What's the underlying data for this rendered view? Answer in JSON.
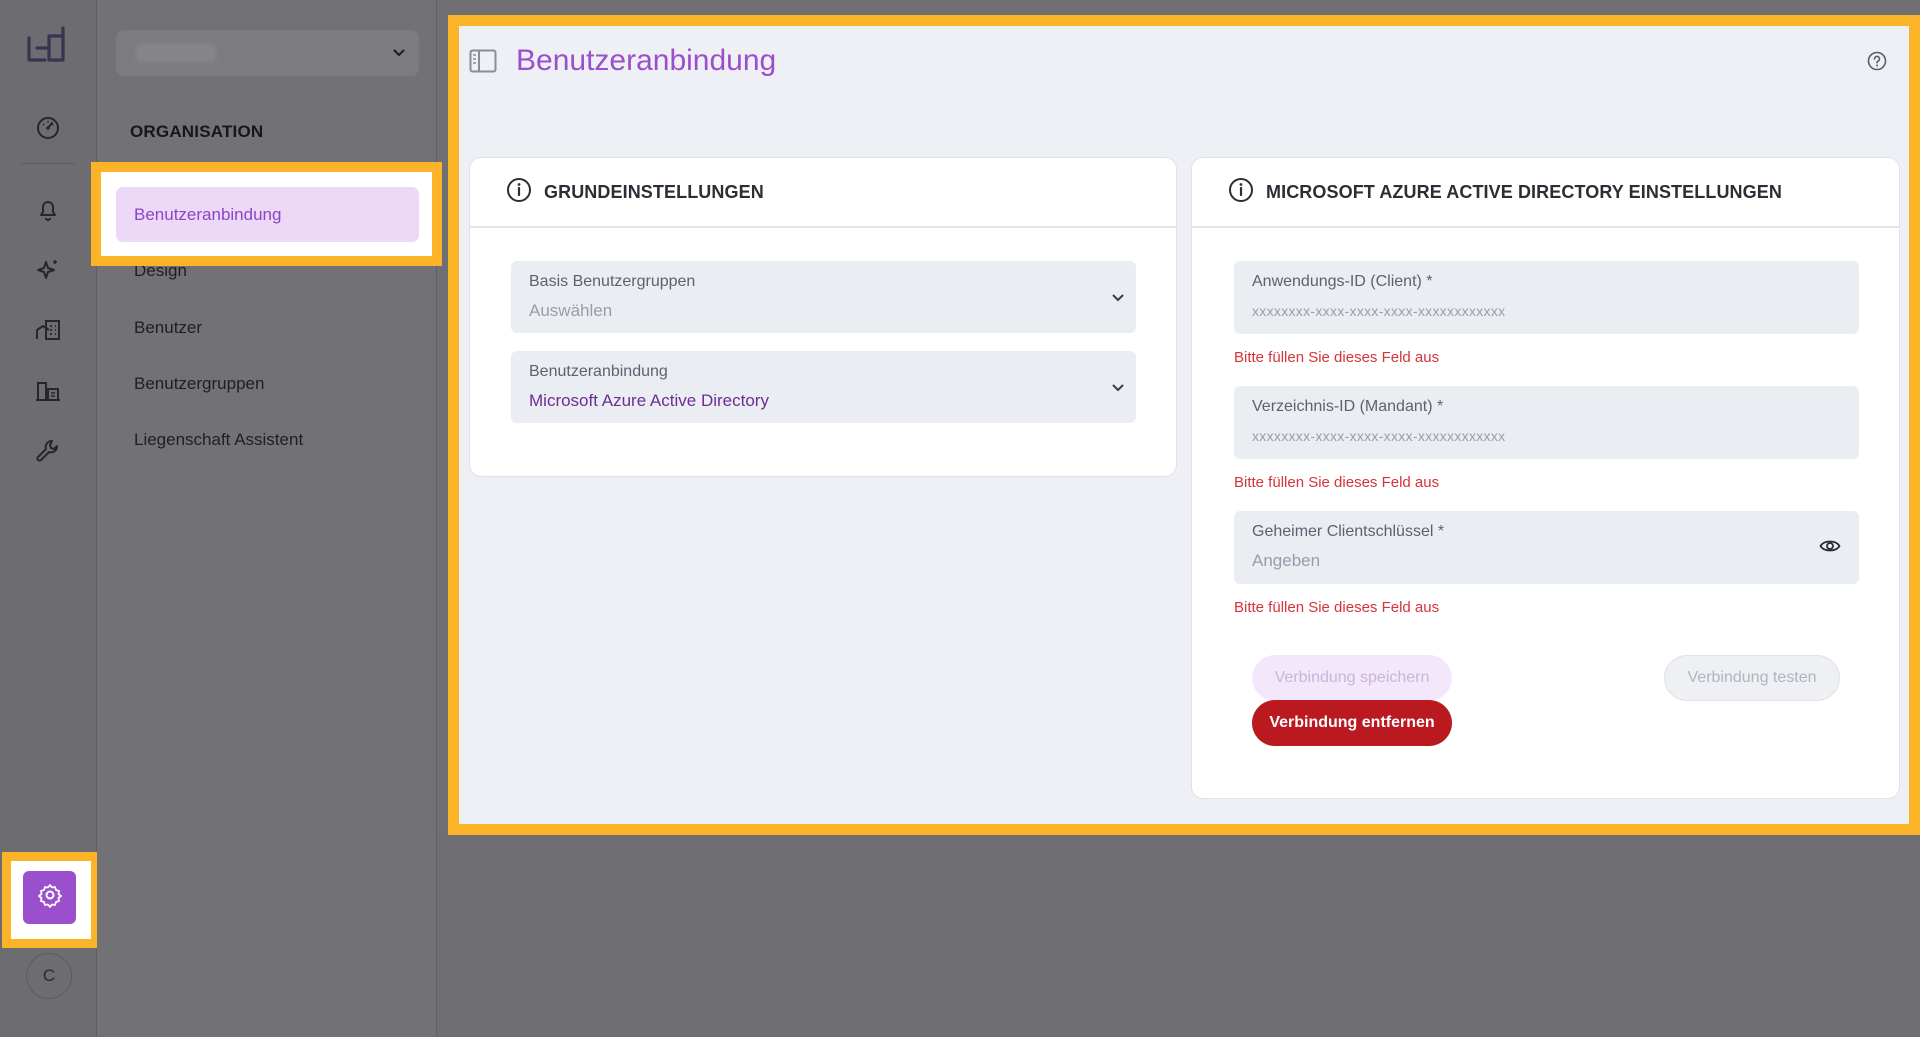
{
  "nav_rail": {
    "icons": [
      "dashboard-icon",
      "bell-icon",
      "sparkle-icon",
      "building-icon",
      "property-icon",
      "wrench-icon"
    ],
    "settings_icon": "gear-icon",
    "avatar_initial": "C"
  },
  "sidebar": {
    "org_select_placeholder": "",
    "section_title": "ORGANISATION",
    "items": [
      {
        "label": "Benutzeranbindung",
        "active": true
      },
      {
        "label": "Design"
      },
      {
        "label": "Benutzer"
      },
      {
        "label": "Benutzergruppen"
      },
      {
        "label": "Liegenschaft Assistent"
      }
    ]
  },
  "main": {
    "title": "Benutzeranbindung",
    "basic_card": {
      "title": "GRUNDEINSTELLUNGEN",
      "fields": [
        {
          "label": "Basis Benutzergruppen",
          "value": "Auswählen"
        },
        {
          "label": "Benutzeranbindung",
          "value": "Microsoft Azure Active Directory"
        }
      ]
    },
    "azure_card": {
      "title": "MICROSOFT AZURE ACTIVE DIRECTORY EINSTELLUNGEN",
      "fields": [
        {
          "label": "Anwendungs-ID (Client) *",
          "placeholder": "xxxxxxxx-xxxx-xxxx-xxxx-xxxxxxxxxxxx",
          "error": "Bitte füllen Sie dieses Feld aus"
        },
        {
          "label": "Verzeichnis-ID (Mandant) *",
          "placeholder": "xxxxxxxx-xxxx-xxxx-xxxx-xxxxxxxxxxxx",
          "error": "Bitte füllen Sie dieses Feld aus"
        },
        {
          "label": "Geheimer Clientschlüssel *",
          "placeholder": "Angeben",
          "error": "Bitte füllen Sie dieses Feld aus"
        }
      ],
      "buttons": {
        "save": "Verbindung speichern",
        "test": "Verbindung testen",
        "remove": "Verbindung entfernen"
      }
    }
  },
  "colors": {
    "accent": "#9a4fcc",
    "highlight": "#fbb328",
    "error": "#d6333a",
    "danger_button": "#ba1a1f"
  }
}
